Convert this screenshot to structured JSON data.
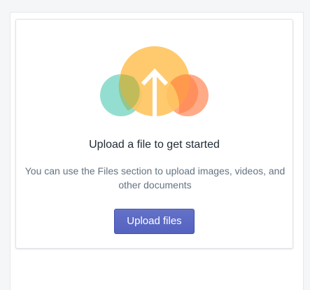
{
  "empty_state": {
    "heading": "Upload a file to get started",
    "description": "You can use the Files section to upload images, videos, and other documents",
    "button_label": "Upload files",
    "illustration_icon": "cloud-upload-icon"
  },
  "colors": {
    "teal": "#96dfd4",
    "yellow": "#ffc96b",
    "orange": "#ffa47e",
    "button": "#5c6ac4"
  }
}
